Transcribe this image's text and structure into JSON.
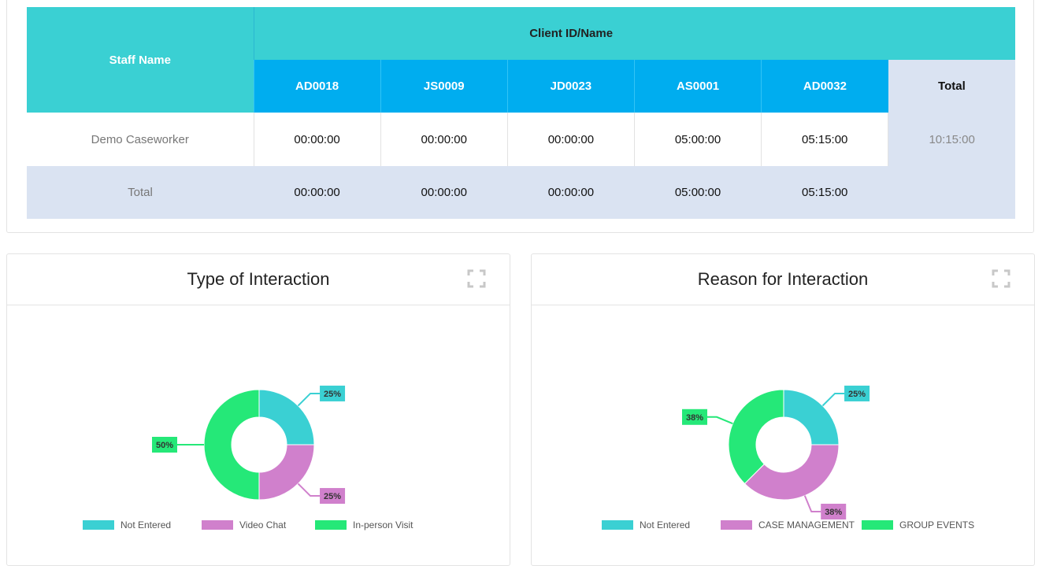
{
  "table": {
    "staff_header": "Staff Name",
    "group_header": "Client ID/Name",
    "clients": [
      "AD0018",
      "JS0009",
      "JD0023",
      "AS0001",
      "AD0032"
    ],
    "total_header": "Total",
    "rows": [
      {
        "staff": "Demo Caseworker",
        "values": [
          "00:00:00",
          "00:00:00",
          "00:00:00",
          "05:00:00",
          "05:15:00"
        ],
        "total": "10:15:00"
      }
    ],
    "totals_row": {
      "label": "Total",
      "values": [
        "00:00:00",
        "00:00:00",
        "00:00:00",
        "05:00:00",
        "05:15:00"
      ]
    }
  },
  "charts": {
    "type": {
      "title": "Type of Interaction"
    },
    "reason": {
      "title": "Reason for Interaction"
    }
  },
  "chart_data": [
    {
      "type": "pie",
      "title": "Type of Interaction",
      "categories": [
        "Not Entered",
        "Video Chat",
        "In-person Visit"
      ],
      "values": [
        25,
        25,
        50
      ],
      "labels": [
        "25%",
        "25%",
        "50%"
      ],
      "colors": [
        "#3ad0d3",
        "#d080cc",
        "#25e878"
      ],
      "legend": "bottom"
    },
    {
      "type": "pie",
      "title": "Reason for Interaction",
      "categories": [
        "Not Entered",
        "CASE MANAGEMENT",
        "GROUP EVENTS"
      ],
      "values": [
        25,
        37.5,
        37.5
      ],
      "labels": [
        "25%",
        "38%",
        "38%"
      ],
      "colors": [
        "#3ad0d3",
        "#d080cc",
        "#25e878"
      ],
      "legend": "bottom"
    }
  ]
}
